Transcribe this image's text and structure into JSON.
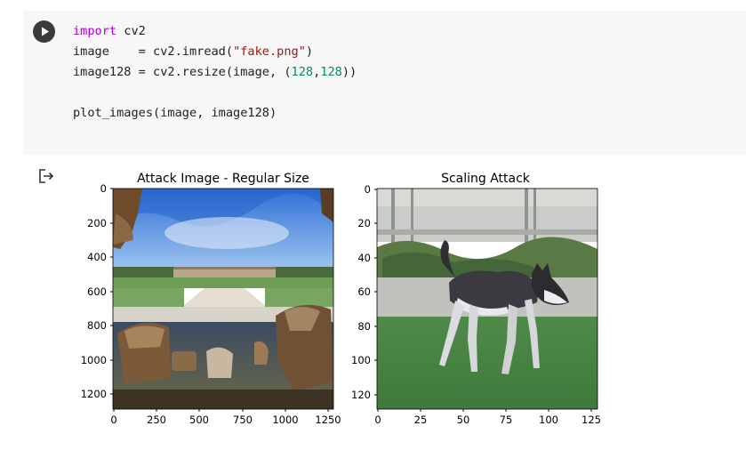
{
  "code_cell": {
    "line1": {
      "kw": "import",
      "rest": " cv2"
    },
    "line2": {
      "var": "image    = cv2.imread(",
      "str": "\"fake.png\"",
      "end": ")"
    },
    "line3": {
      "pre": "image128 = cv2.resize(image, (",
      "n1": "128",
      "comma": ",",
      "n2": "128",
      "end": "))"
    },
    "line5": "plot_images(image, image128)"
  },
  "icons": {
    "run": "play-icon",
    "output": "output-arrow-icon"
  },
  "colors": {
    "cell_bg": "#f7f7f7",
    "keyword": "#af00db",
    "string": "#a31515",
    "number": "#09885a"
  },
  "plots": [
    {
      "title": "Attack Image - Regular Size",
      "x_ticks": [
        "0",
        "250",
        "500",
        "750",
        "1000",
        "1250"
      ],
      "y_ticks": [
        "0",
        "200",
        "400",
        "600",
        "800",
        "1000",
        "1200"
      ],
      "image": "palace-garden-photo"
    },
    {
      "title": "Scaling Attack",
      "x_ticks": [
        "0",
        "25",
        "50",
        "75",
        "100",
        "125"
      ],
      "y_ticks": [
        "0",
        "20",
        "40",
        "60",
        "80",
        "100",
        "120"
      ],
      "image": "husky-dog-photo"
    }
  ]
}
